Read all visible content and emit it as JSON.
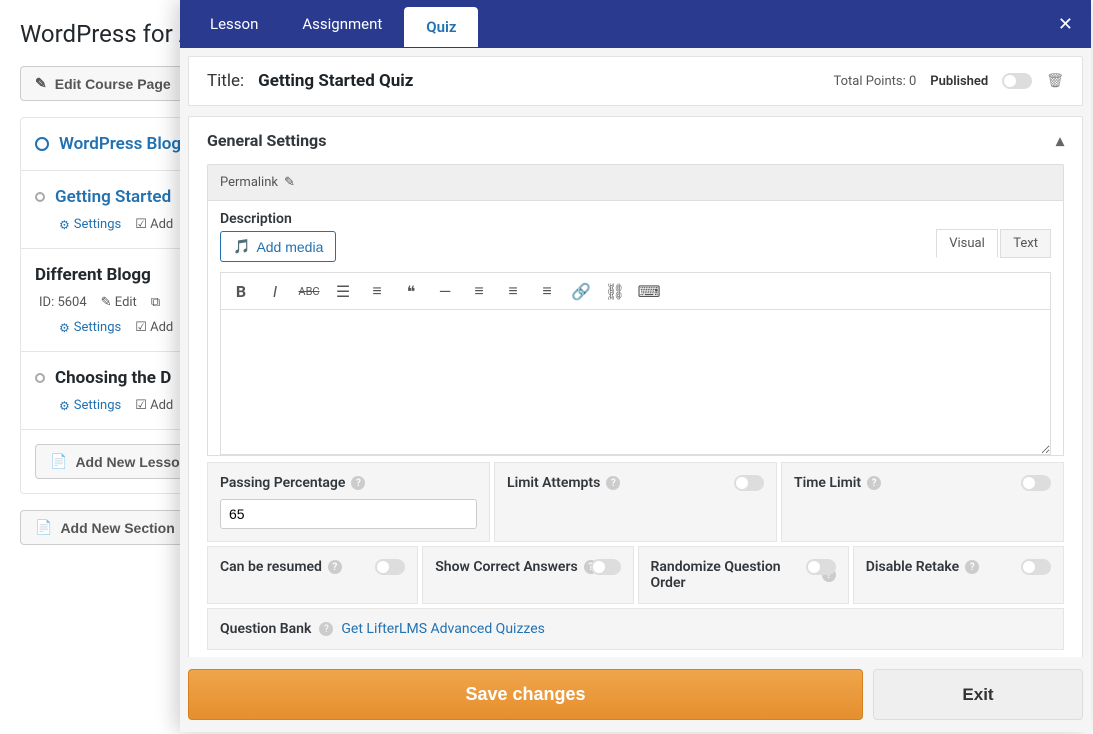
{
  "course": {
    "title": "WordPress for A",
    "edit_button": "Edit Course Page",
    "add_section": "Add New Section",
    "add_lesson": "Add New Lesson",
    "sections": [
      {
        "title": "WordPress Blog",
        "link": true
      },
      {
        "title": "Getting Started",
        "link": true,
        "settings": "Settings",
        "add": "Add"
      },
      {
        "title": "Different Blogg",
        "link": false,
        "id_label": "ID: 5604",
        "edit": "Edit",
        "settings": "Settings",
        "add": "Add"
      },
      {
        "title": "Choosing the D",
        "link": false,
        "settings": "Settings",
        "add": "Add"
      }
    ]
  },
  "modal": {
    "tabs": {
      "lesson": "Lesson",
      "assignment": "Assignment",
      "quiz": "Quiz"
    },
    "title_label": "Title:",
    "title_value": "Getting Started Quiz",
    "total_points_label": "Total Points:",
    "total_points_value": "0",
    "published_label": "Published",
    "section_title": "General Settings",
    "permalink_label": "Permalink",
    "description_label": "Description",
    "add_media": "Add media",
    "editor_tabs": {
      "visual": "Visual",
      "text": "Text"
    },
    "settings": {
      "passing_percentage": "Passing Percentage",
      "passing_percentage_value": "65",
      "limit_attempts": "Limit Attempts",
      "time_limit": "Time Limit",
      "can_be_resumed": "Can be resumed",
      "show_correct_answers": "Show Correct Answers",
      "randomize_question_order": "Randomize Question Order",
      "disable_retake": "Disable Retake"
    },
    "question_bank": {
      "label": "Question Bank",
      "link": "Get LifterLMS Advanced Quizzes"
    },
    "footer": {
      "save": "Save changes",
      "exit": "Exit"
    }
  }
}
